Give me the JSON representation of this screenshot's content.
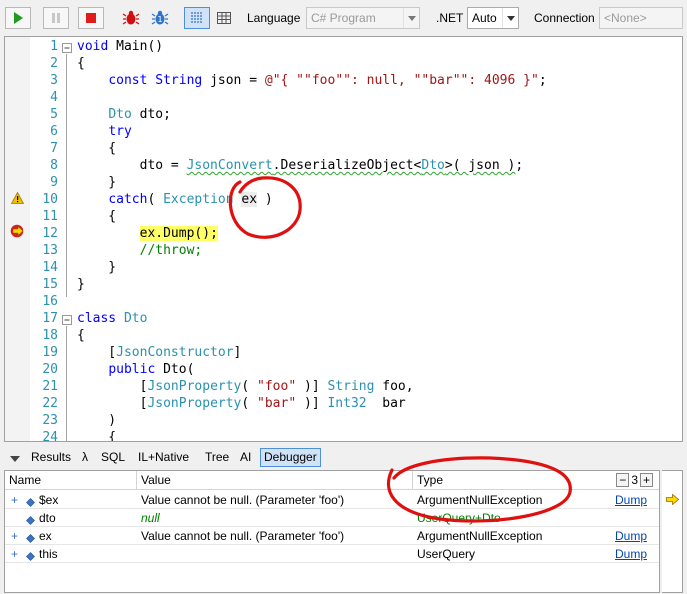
{
  "toolbar": {
    "language_label": "Language",
    "language_value": "C# Program",
    "dotnet_label": ".NET",
    "dotnet_value": "Auto",
    "connection_label": "Connection",
    "connection_value": "<None>",
    "buttons": [
      "run-icon",
      "pause-icon",
      "stop-icon",
      "bug-icon",
      "step-bug-icon",
      "results-rich-icon",
      "results-grid-icon"
    ]
  },
  "editor": {
    "lines": [
      {
        "n": "1",
        "html": "<span class='kw'>void</span> Main()"
      },
      {
        "n": "2",
        "html": "{"
      },
      {
        "n": "3",
        "html": "    <span class='kw'>const</span> <span class='kw'>String</span> json = <span class='str'>@\"{ \"\"foo\"\": null, \"\"bar\"\": 4096 }\"</span>;"
      },
      {
        "n": "4",
        "html": ""
      },
      {
        "n": "5",
        "html": "    <span class='ty'>Dto</span> dto;"
      },
      {
        "n": "6",
        "html": "    <span class='kw'>try</span>"
      },
      {
        "n": "7",
        "html": "    {"
      },
      {
        "n": "8",
        "html": "        dto = <span class='ty squiggle'>JsonConvert</span><span class='squiggle'>.DeserializeObject&lt;<span class='ty'>Dto</span>&gt;( json )</span>;"
      },
      {
        "n": "9",
        "html": "    }"
      },
      {
        "n": "10",
        "html": "    <span class='kw'>catch</span>( <span class='ty'>Exception</span> <span class='hl-gray'>ex</span> )"
      },
      {
        "n": "11",
        "html": "    {"
      },
      {
        "n": "12",
        "html": "        <span class='hl-yellow'>ex.Dump();</span>"
      },
      {
        "n": "13",
        "html": "        <span class='cm'>//throw;</span>"
      },
      {
        "n": "14",
        "html": "    }"
      },
      {
        "n": "15",
        "html": "}"
      },
      {
        "n": "16",
        "html": ""
      },
      {
        "n": "17",
        "html": "<span class='kw'>class</span> <span class='ty'>Dto</span>"
      },
      {
        "n": "18",
        "html": "{"
      },
      {
        "n": "19",
        "html": "    [<span class='ty'>JsonConstructor</span>]"
      },
      {
        "n": "20",
        "html": "    <span class='kw'>public</span> Dto("
      },
      {
        "n": "21",
        "html": "        [<span class='ty'>JsonProperty</span>( <span class='str'>\"foo\"</span> )] <span class='ty'>String</span> foo,"
      },
      {
        "n": "22",
        "html": "        [<span class='ty'>JsonProperty</span>( <span class='str'>\"bar\"</span> )] <span class='ty'>Int32</span>  bar"
      },
      {
        "n": "23",
        "html": "    )"
      },
      {
        "n": "24",
        "html": "    {"
      }
    ]
  },
  "tabs": [
    {
      "id": "results",
      "label": "Results",
      "active": false
    },
    {
      "id": "lambda",
      "label": "λ",
      "active": false
    },
    {
      "id": "sql",
      "label": "SQL",
      "active": false
    },
    {
      "id": "il",
      "label": "IL+Native",
      "active": false
    },
    {
      "id": "tree",
      "label": "Tree",
      "active": false
    },
    {
      "id": "ai",
      "label": "AI",
      "active": false
    },
    {
      "id": "debugger",
      "label": "Debugger",
      "active": true
    }
  ],
  "debugger": {
    "columns": {
      "name": "Name",
      "value": "Value",
      "type": "Type"
    },
    "counter": {
      "minus": "−",
      "count": "3",
      "plus": "+"
    },
    "rows": [
      {
        "expand": "+",
        "name": "$ex",
        "value": "Value cannot be null. (Parameter 'foo')",
        "type": "ArgumentNullException",
        "link": "Dump"
      },
      {
        "expand": "",
        "name": "dto",
        "value": "null",
        "type": "UserQuery+Dto",
        "link": ""
      },
      {
        "expand": "+",
        "name": "ex",
        "value": "Value cannot be null. (Parameter 'foo')",
        "type": "ArgumentNullException",
        "link": "Dump"
      },
      {
        "expand": "+",
        "name": "this",
        "value": "",
        "type": "UserQuery",
        "link": "Dump"
      }
    ]
  },
  "colors": {
    "keyword": "#0000ff",
    "type": "#2b91af",
    "string": "#a31515",
    "comment": "#008000",
    "current_line": "#ffff66",
    "annotation": "#e01010"
  }
}
